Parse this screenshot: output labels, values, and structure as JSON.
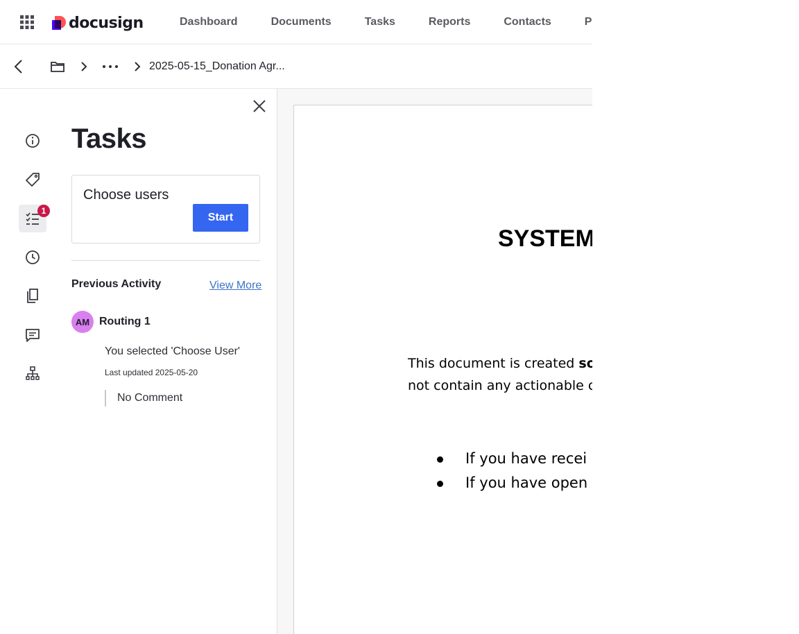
{
  "brand": {
    "name": "docusign",
    "accent": "#3466f0"
  },
  "nav": {
    "links": [
      "Dashboard",
      "Documents",
      "Tasks",
      "Reports",
      "Contacts",
      "Part"
    ]
  },
  "breadcrumb": {
    "current": "2025-05-15_Donation Agr..."
  },
  "rail": {
    "tasks_badge": "1",
    "icons": [
      "info-icon",
      "tag-icon",
      "tasks-icon",
      "history-icon",
      "copy-icon",
      "comment-icon",
      "hierarchy-icon"
    ]
  },
  "panel": {
    "title": "Tasks",
    "card": {
      "title": "Choose users",
      "start_label": "Start"
    },
    "previous_activity": {
      "heading": "Previous Activity",
      "view_more": "View More",
      "entry": {
        "initials": "AM",
        "routing": "Routing 1",
        "description": "You selected 'Choose User'",
        "updated": "Last updated 2025-05-20",
        "comment": "No Comment"
      }
    }
  },
  "document": {
    "heading": "SYSTEM",
    "paragraph_line1_prefix": "This document is created ",
    "paragraph_line1_bold": "sol",
    "paragraph_line2": "not contain any actionable co",
    "bullets": [
      "If you have recei",
      "If you have open"
    ]
  }
}
